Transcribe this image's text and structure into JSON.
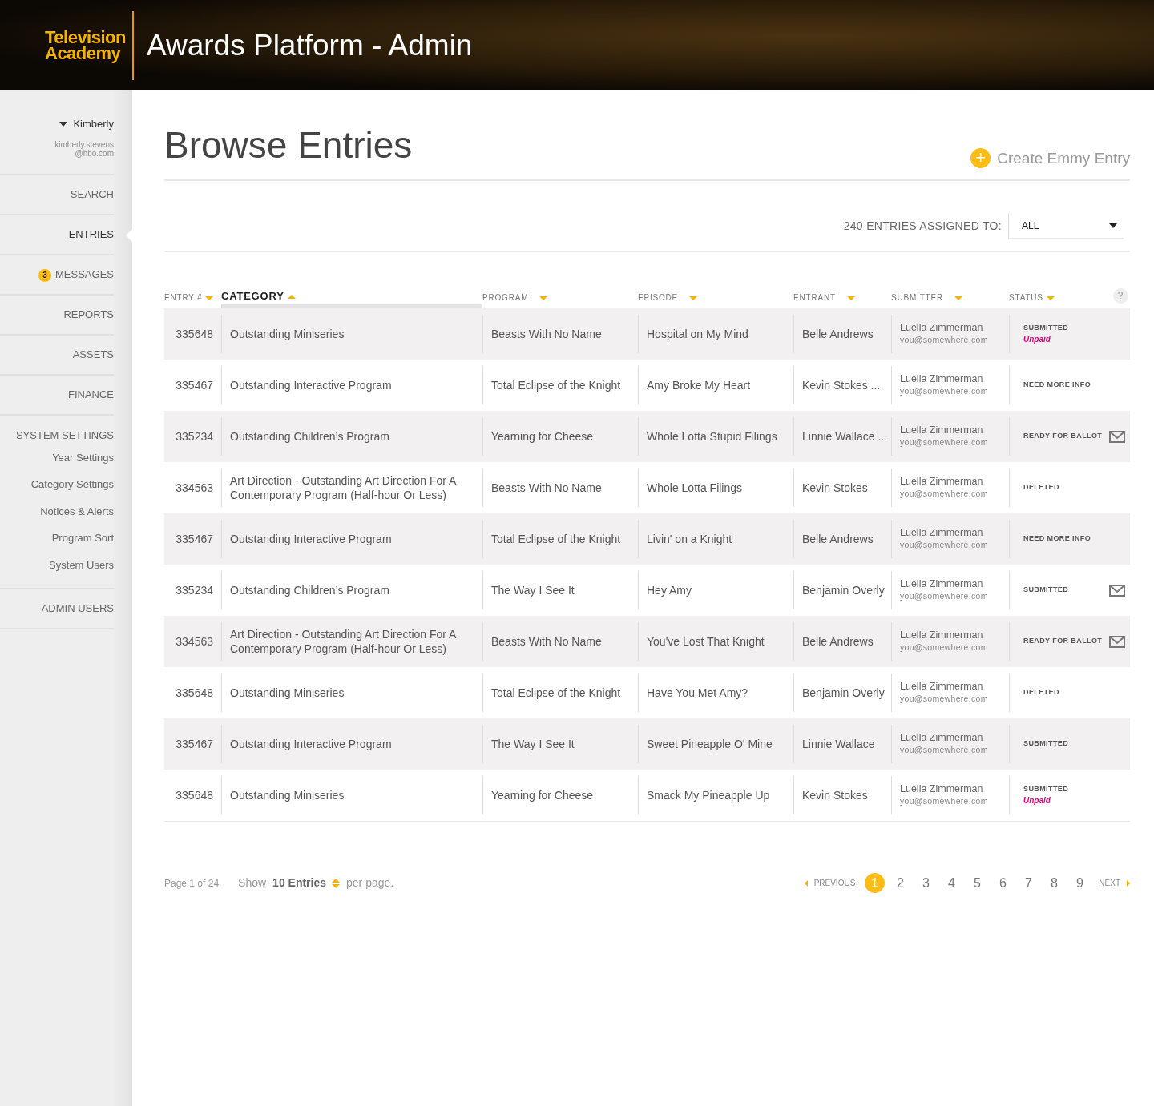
{
  "header": {
    "logo_lines": [
      "Television",
      "Academy"
    ],
    "title": "Awards Platform - Admin"
  },
  "sidebar": {
    "user": {
      "name": "Kimberly",
      "email_lines": [
        "kimberly.stevens",
        "@hbo.com"
      ]
    },
    "items": [
      {
        "label": "SEARCH",
        "kind": "main",
        "selected": false
      },
      {
        "label": "ENTRIES",
        "kind": "main",
        "selected": true
      },
      {
        "label": "MESSAGES",
        "kind": "main",
        "selected": false,
        "badge": "3"
      },
      {
        "label": "REPORTS",
        "kind": "main",
        "selected": false
      },
      {
        "label": "ASSETS",
        "kind": "main",
        "selected": false
      },
      {
        "label": "FINANCE",
        "kind": "main",
        "selected": false
      },
      {
        "label": "SYSTEM SETTINGS",
        "kind": "group",
        "selected": false,
        "children": [
          {
            "label": "Year Settings",
            "selected": false
          },
          {
            "label": "Category Settings",
            "selected": false
          },
          {
            "label": "Notices & Alerts",
            "selected": false
          },
          {
            "label": "Program Sort",
            "selected": false
          },
          {
            "label": "System Users",
            "selected": false
          }
        ]
      },
      {
        "label": "ADMIN USERS",
        "kind": "main",
        "selected": false
      }
    ]
  },
  "page": {
    "title": "Browse Entries",
    "create_button": "Create Emmy Entry",
    "icon_text": "+"
  },
  "filter": {
    "label": "240 ENTRIES ASSIGNED TO:",
    "value": "ALL"
  },
  "table": {
    "columns": [
      {
        "label": "ENTRY #",
        "ascending": false,
        "selected": false
      },
      {
        "label": "CATEGORY",
        "ascending": true,
        "selected": true
      },
      {
        "label": "PROGRAM",
        "ascending": false,
        "selected": false
      },
      {
        "label": "EPISODE",
        "ascending": false,
        "selected": false
      },
      {
        "label": "ENTRANT",
        "ascending": false,
        "selected": false
      },
      {
        "label": "SUBMITTER",
        "ascending": false,
        "selected": false
      },
      {
        "label": "STATUS",
        "ascending": false,
        "selected": false
      }
    ],
    "help": "?",
    "rows": [
      {
        "entry": "335648",
        "category": "Outstanding Miniseries",
        "program": "Beasts With No Name",
        "episode": "Hospital on My Mind",
        "entrant": "Belle Andrews",
        "submitter": "Luella Zimmerman",
        "email": "you@somewhere.com",
        "status": "SUBMITTED",
        "note": "Unpaid",
        "mail": false
      },
      {
        "entry": "335467",
        "category": "Outstanding Interactive Program",
        "program": "Total Eclipse of the Knight",
        "episode": "Amy Broke My Heart",
        "entrant": "Kevin Stokes ...",
        "submitter": "Luella Zimmerman",
        "email": "you@somewhere.com",
        "status": "NEED MORE INFO",
        "mail": false
      },
      {
        "entry": "335234",
        "category": "Outstanding Children’s Program",
        "program": "Yearning for Cheese",
        "episode": "Whole Lotta Stupid  Filings",
        "entrant": "Linnie Wallace ...",
        "submitter": "Luella Zimmerman",
        "email": "you@somewhere.com",
        "status": "READY FOR BALLOT",
        "mail": true
      },
      {
        "entry": "334563",
        "category": "Art Direction - Outstanding Art Direction For A Contemporary Program (Half-hour Or Less)",
        "program": "Beasts With No Name",
        "episode": "Whole Lotta Filings",
        "entrant": "Kevin Stokes",
        "submitter": "Luella Zimmerman",
        "email": "you@somewhere.com",
        "status": "DELETED",
        "mail": false
      },
      {
        "entry": "335467",
        "category": "Outstanding Interactive Program",
        "program": "Total Eclipse of the Knight",
        "episode": "Livin' on a Knight",
        "entrant": "Belle Andrews",
        "submitter": "Luella Zimmerman",
        "email": "you@somewhere.com",
        "status": "NEED MORE INFO",
        "mail": false
      },
      {
        "entry": "335234",
        "category": "Outstanding Children’s Program",
        "program": "The Way I See It",
        "episode": "Hey Amy",
        "entrant": "Benjamin Overly",
        "submitter": "Luella Zimmerman",
        "email": "you@somewhere.com",
        "status": "SUBMITTED",
        "mail": true
      },
      {
        "entry": "334563",
        "category": "Art Direction - Outstanding Art Direction For A Contemporary Program (Half-hour Or Less)",
        "program": "Beasts With No Name",
        "episode": "You've Lost That Knight",
        "entrant": "Belle Andrews",
        "submitter": "Luella Zimmerman",
        "email": "you@somewhere.com",
        "status": "READY FOR BALLOT",
        "mail": true
      },
      {
        "entry": "335648",
        "category": "Outstanding Miniseries",
        "program": "Total Eclipse of the Knight",
        "episode": "Have You Met Amy?",
        "entrant": "Benjamin Overly",
        "submitter": "Luella Zimmerman",
        "email": "you@somewhere.com",
        "status": "DELETED",
        "mail": false
      },
      {
        "entry": "335467",
        "category": "Outstanding Interactive Program",
        "program": "The Way I See It",
        "episode": "Sweet Pineapple O' Mine",
        "entrant": "Linnie Wallace",
        "submitter": "Luella Zimmerman",
        "email": "you@somewhere.com",
        "status": "SUBMITTED",
        "mail": false
      },
      {
        "entry": "335648",
        "category": "Outstanding Miniseries",
        "program": "Yearning for Cheese",
        "episode": "Smack My Pineapple Up",
        "entrant": "Kevin Stokes",
        "submitter": "Luella Zimmerman",
        "email": "you@somewhere.com",
        "status": "SUBMITTED",
        "note": "Unpaid",
        "mail": false
      }
    ]
  },
  "footer": {
    "page_info": "Page 1 of 24",
    "show_label": "Show",
    "per_page": "10 Entries",
    "per_page_suffix": "per page.",
    "previous": "PREVIOUS",
    "next": "NEXT",
    "pages": [
      {
        "label": "1",
        "selected": true
      },
      {
        "label": "2",
        "selected": false
      },
      {
        "label": "3",
        "selected": false
      },
      {
        "label": "4",
        "selected": false
      },
      {
        "label": "5",
        "selected": false
      },
      {
        "label": "6",
        "selected": false
      },
      {
        "label": "7",
        "selected": false
      },
      {
        "label": "8",
        "selected": false
      },
      {
        "label": "9",
        "selected": false
      }
    ]
  }
}
